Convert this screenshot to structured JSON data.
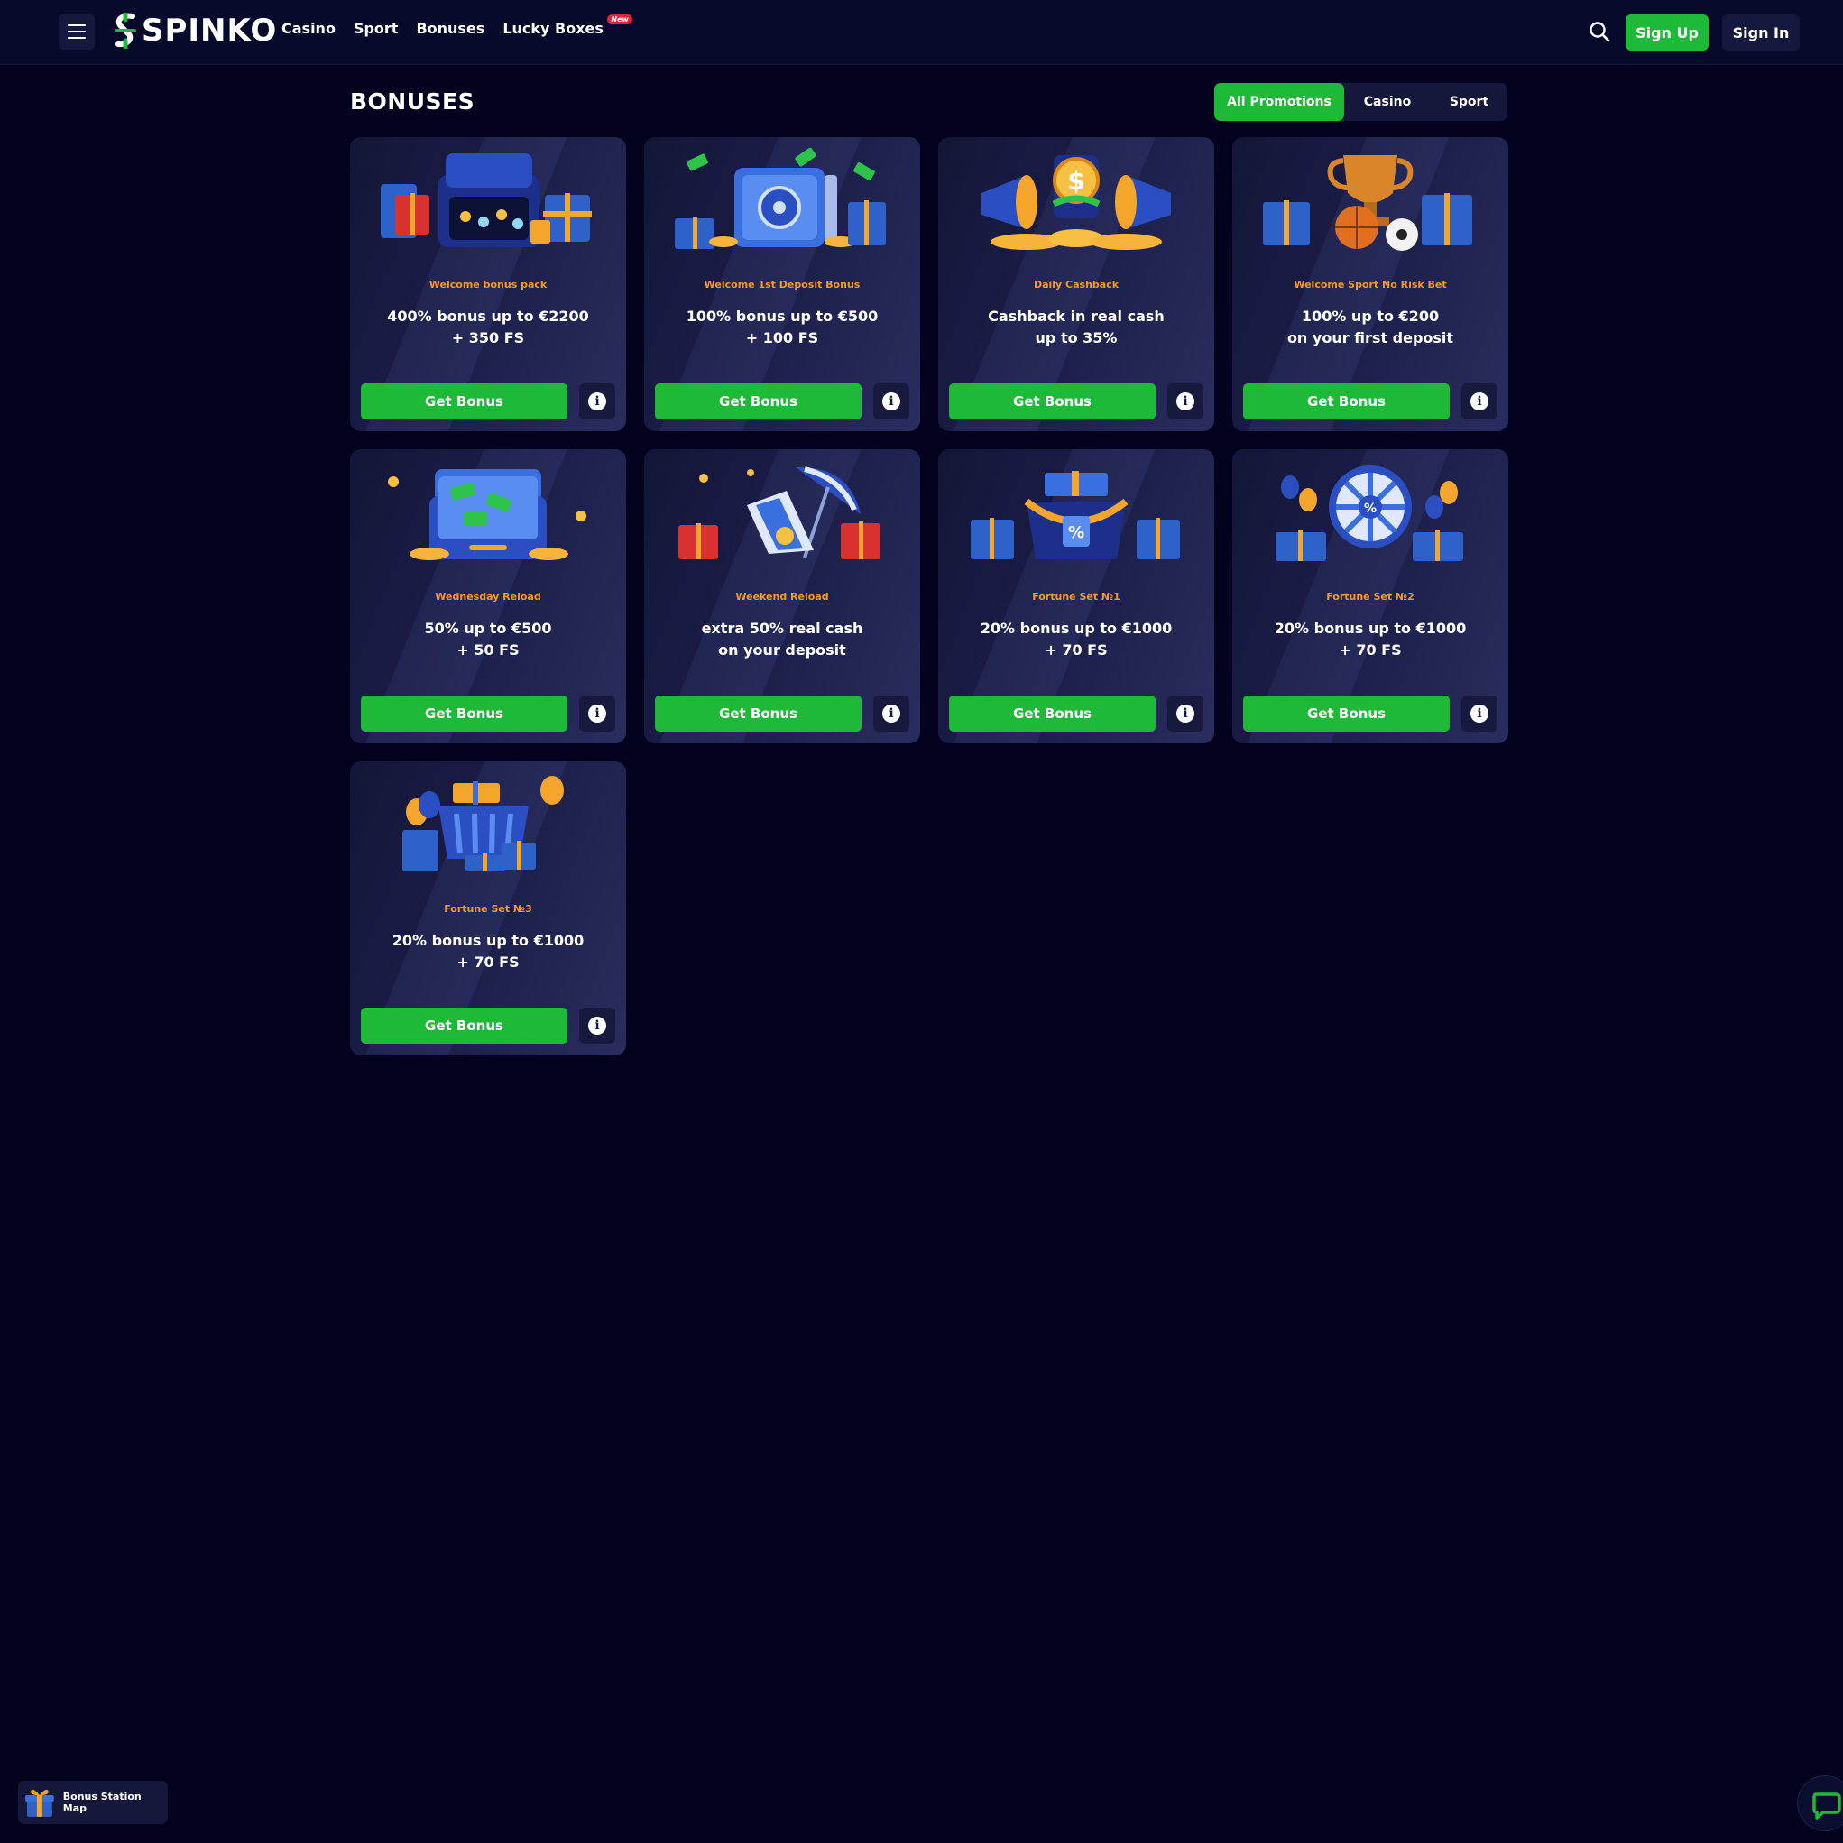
{
  "header": {
    "logo_text": "SPINKO",
    "nav": [
      {
        "label": "Casino"
      },
      {
        "label": "Sport"
      },
      {
        "label": "Bonuses"
      },
      {
        "label": "Lucky Boxes",
        "badge": "New"
      }
    ],
    "signup_label": "Sign Up",
    "signin_label": "Sign In"
  },
  "page": {
    "title": "BONUSES",
    "filters": [
      {
        "label": "All Promotions",
        "active": true
      },
      {
        "label": "Casino",
        "active": false
      },
      {
        "label": "Sport",
        "active": false
      }
    ]
  },
  "cards": [
    {
      "category": "Welcome bonus pack",
      "title": "400% bonus up to €2200\n+ 350 FS",
      "button": "Get Bonus",
      "art": "suitcase-gifts"
    },
    {
      "category": "Welcome 1st Deposit Bonus",
      "title": "100% bonus up to €500\n+ 100 FS",
      "button": "Get Bonus",
      "art": "safe-money"
    },
    {
      "category": "Daily Cashback",
      "title": "Cashback in real cash\nup to 35%",
      "button": "Get Bonus",
      "art": "megaphones-coins"
    },
    {
      "category": "Welcome Sport No Risk Bet",
      "title": "100% up to €200\non your first deposit",
      "button": "Get Bonus",
      "art": "trophy-balls"
    },
    {
      "category": "Wednesday Reload",
      "title": "50% up to €500\n+ 50 FS",
      "button": "Get Bonus",
      "art": "suitcase-cash"
    },
    {
      "category": "Weekend Reload",
      "title": "extra 50% real cash\non your deposit",
      "button": "Get Bonus",
      "art": "beach-chair"
    },
    {
      "category": "Fortune Set №1",
      "title": "20% bonus up to €1000\n+ 70 FS",
      "button": "Get Bonus",
      "art": "gift-box-percent"
    },
    {
      "category": "Fortune Set №2",
      "title": "20% bonus up to €1000\n+ 70 FS",
      "button": "Get Bonus",
      "art": "fortune-wheel"
    },
    {
      "category": "Fortune Set №3",
      "title": "20% bonus up to €1000\n+ 70 FS",
      "button": "Get Bonus",
      "art": "shopping-basket"
    }
  ],
  "floating": {
    "bonus_map_label": "Bonus Station Map"
  },
  "colors": {
    "background": "#03021f",
    "accent_green": "#1db937",
    "category_orange": "#f49a21",
    "new_badge_red": "#e52238"
  }
}
